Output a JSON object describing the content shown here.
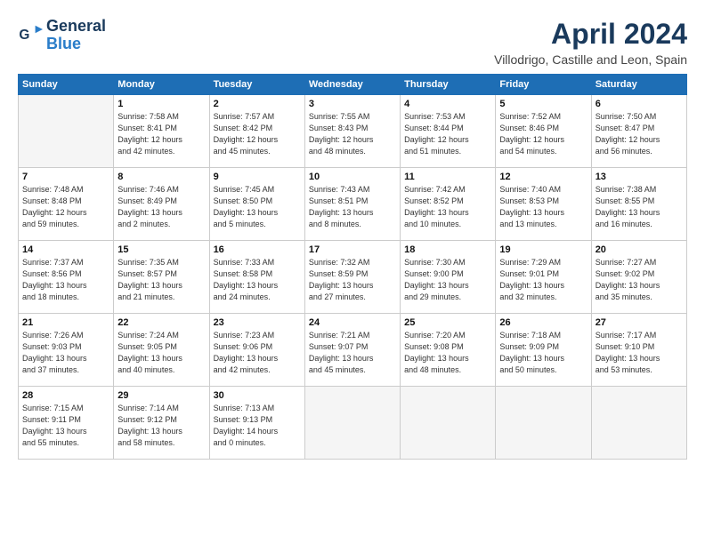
{
  "header": {
    "logo_line1": "General",
    "logo_line2": "Blue",
    "month_title": "April 2024",
    "location": "Villodrigo, Castille and Leon, Spain"
  },
  "weekdays": [
    "Sunday",
    "Monday",
    "Tuesday",
    "Wednesday",
    "Thursday",
    "Friday",
    "Saturday"
  ],
  "weeks": [
    [
      {
        "day": "",
        "info": ""
      },
      {
        "day": "1",
        "info": "Sunrise: 7:58 AM\nSunset: 8:41 PM\nDaylight: 12 hours\nand 42 minutes."
      },
      {
        "day": "2",
        "info": "Sunrise: 7:57 AM\nSunset: 8:42 PM\nDaylight: 12 hours\nand 45 minutes."
      },
      {
        "day": "3",
        "info": "Sunrise: 7:55 AM\nSunset: 8:43 PM\nDaylight: 12 hours\nand 48 minutes."
      },
      {
        "day": "4",
        "info": "Sunrise: 7:53 AM\nSunset: 8:44 PM\nDaylight: 12 hours\nand 51 minutes."
      },
      {
        "day": "5",
        "info": "Sunrise: 7:52 AM\nSunset: 8:46 PM\nDaylight: 12 hours\nand 54 minutes."
      },
      {
        "day": "6",
        "info": "Sunrise: 7:50 AM\nSunset: 8:47 PM\nDaylight: 12 hours\nand 56 minutes."
      }
    ],
    [
      {
        "day": "7",
        "info": "Sunrise: 7:48 AM\nSunset: 8:48 PM\nDaylight: 12 hours\nand 59 minutes."
      },
      {
        "day": "8",
        "info": "Sunrise: 7:46 AM\nSunset: 8:49 PM\nDaylight: 13 hours\nand 2 minutes."
      },
      {
        "day": "9",
        "info": "Sunrise: 7:45 AM\nSunset: 8:50 PM\nDaylight: 13 hours\nand 5 minutes."
      },
      {
        "day": "10",
        "info": "Sunrise: 7:43 AM\nSunset: 8:51 PM\nDaylight: 13 hours\nand 8 minutes."
      },
      {
        "day": "11",
        "info": "Sunrise: 7:42 AM\nSunset: 8:52 PM\nDaylight: 13 hours\nand 10 minutes."
      },
      {
        "day": "12",
        "info": "Sunrise: 7:40 AM\nSunset: 8:53 PM\nDaylight: 13 hours\nand 13 minutes."
      },
      {
        "day": "13",
        "info": "Sunrise: 7:38 AM\nSunset: 8:55 PM\nDaylight: 13 hours\nand 16 minutes."
      }
    ],
    [
      {
        "day": "14",
        "info": "Sunrise: 7:37 AM\nSunset: 8:56 PM\nDaylight: 13 hours\nand 18 minutes."
      },
      {
        "day": "15",
        "info": "Sunrise: 7:35 AM\nSunset: 8:57 PM\nDaylight: 13 hours\nand 21 minutes."
      },
      {
        "day": "16",
        "info": "Sunrise: 7:33 AM\nSunset: 8:58 PM\nDaylight: 13 hours\nand 24 minutes."
      },
      {
        "day": "17",
        "info": "Sunrise: 7:32 AM\nSunset: 8:59 PM\nDaylight: 13 hours\nand 27 minutes."
      },
      {
        "day": "18",
        "info": "Sunrise: 7:30 AM\nSunset: 9:00 PM\nDaylight: 13 hours\nand 29 minutes."
      },
      {
        "day": "19",
        "info": "Sunrise: 7:29 AM\nSunset: 9:01 PM\nDaylight: 13 hours\nand 32 minutes."
      },
      {
        "day": "20",
        "info": "Sunrise: 7:27 AM\nSunset: 9:02 PM\nDaylight: 13 hours\nand 35 minutes."
      }
    ],
    [
      {
        "day": "21",
        "info": "Sunrise: 7:26 AM\nSunset: 9:03 PM\nDaylight: 13 hours\nand 37 minutes."
      },
      {
        "day": "22",
        "info": "Sunrise: 7:24 AM\nSunset: 9:05 PM\nDaylight: 13 hours\nand 40 minutes."
      },
      {
        "day": "23",
        "info": "Sunrise: 7:23 AM\nSunset: 9:06 PM\nDaylight: 13 hours\nand 42 minutes."
      },
      {
        "day": "24",
        "info": "Sunrise: 7:21 AM\nSunset: 9:07 PM\nDaylight: 13 hours\nand 45 minutes."
      },
      {
        "day": "25",
        "info": "Sunrise: 7:20 AM\nSunset: 9:08 PM\nDaylight: 13 hours\nand 48 minutes."
      },
      {
        "day": "26",
        "info": "Sunrise: 7:18 AM\nSunset: 9:09 PM\nDaylight: 13 hours\nand 50 minutes."
      },
      {
        "day": "27",
        "info": "Sunrise: 7:17 AM\nSunset: 9:10 PM\nDaylight: 13 hours\nand 53 minutes."
      }
    ],
    [
      {
        "day": "28",
        "info": "Sunrise: 7:15 AM\nSunset: 9:11 PM\nDaylight: 13 hours\nand 55 minutes."
      },
      {
        "day": "29",
        "info": "Sunrise: 7:14 AM\nSunset: 9:12 PM\nDaylight: 13 hours\nand 58 minutes."
      },
      {
        "day": "30",
        "info": "Sunrise: 7:13 AM\nSunset: 9:13 PM\nDaylight: 14 hours\nand 0 minutes."
      },
      {
        "day": "",
        "info": ""
      },
      {
        "day": "",
        "info": ""
      },
      {
        "day": "",
        "info": ""
      },
      {
        "day": "",
        "info": ""
      }
    ]
  ]
}
